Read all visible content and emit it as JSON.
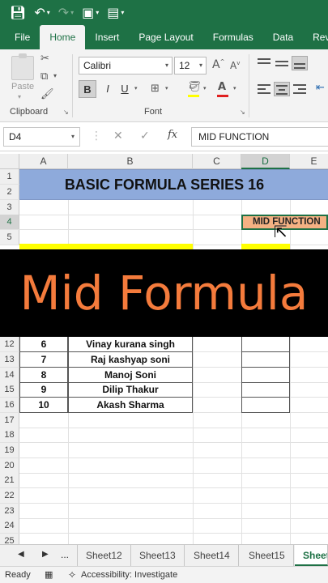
{
  "qat": {
    "icons": [
      "save-icon",
      "undo-icon",
      "redo-icon",
      "paint-icon",
      "form-icon"
    ]
  },
  "tabs": [
    {
      "label": "File",
      "active": false
    },
    {
      "label": "Home",
      "active": true
    },
    {
      "label": "Insert",
      "active": false
    },
    {
      "label": "Page Layout",
      "active": false
    },
    {
      "label": "Formulas",
      "active": false
    },
    {
      "label": "Data",
      "active": false
    },
    {
      "label": "Revi",
      "active": false
    }
  ],
  "ribbon": {
    "paste_label": "Paste",
    "clipboard_label": "Clipboard",
    "font_label": "Font",
    "font_name": "Calibri",
    "font_size": "12",
    "bold": "B",
    "italic": "I",
    "underline": "U",
    "grow_font": "A",
    "shrink_font": "A"
  },
  "formula_bar": {
    "name_box": "D4",
    "fx": "fx",
    "content": "MID FUNCTION"
  },
  "grid": {
    "columns": [
      "A",
      "B",
      "C",
      "D",
      "E"
    ],
    "selected_column": "D",
    "rows": [
      "1",
      "2",
      "3",
      "4",
      "5",
      "12",
      "13",
      "14",
      "15",
      "16",
      "17",
      "18",
      "19",
      "20",
      "21",
      "22",
      "23",
      "24",
      "25"
    ],
    "selected_row": "4",
    "title": "BASIC FORMULA SERIES 16",
    "active_cell": "MID FUNCTION",
    "data_rows": [
      {
        "num": "6",
        "name": "Vinay kurana singh"
      },
      {
        "num": "7",
        "name": "Raj kashyap soni"
      },
      {
        "num": "8",
        "name": "Manoj Soni"
      },
      {
        "num": "9",
        "name": "Dilip Thakur"
      },
      {
        "num": "10",
        "name": "Akash Sharma"
      }
    ]
  },
  "banner": {
    "text": "Mid Formula",
    "color": "#f47b3c"
  },
  "sheets": {
    "ellipsis": "...",
    "tabs": [
      "Sheet12",
      "Sheet13",
      "Sheet14",
      "Sheet15",
      "Sheet"
    ],
    "active_index": 4
  },
  "status": {
    "ready": "Ready",
    "accessibility": "Accessibility: Investigate"
  },
  "colors": {
    "excel_green": "#1e7145",
    "title_band": "#8eaadb",
    "active_cell_fill": "#f4b183",
    "highlight_yellow": "#ffff00"
  }
}
